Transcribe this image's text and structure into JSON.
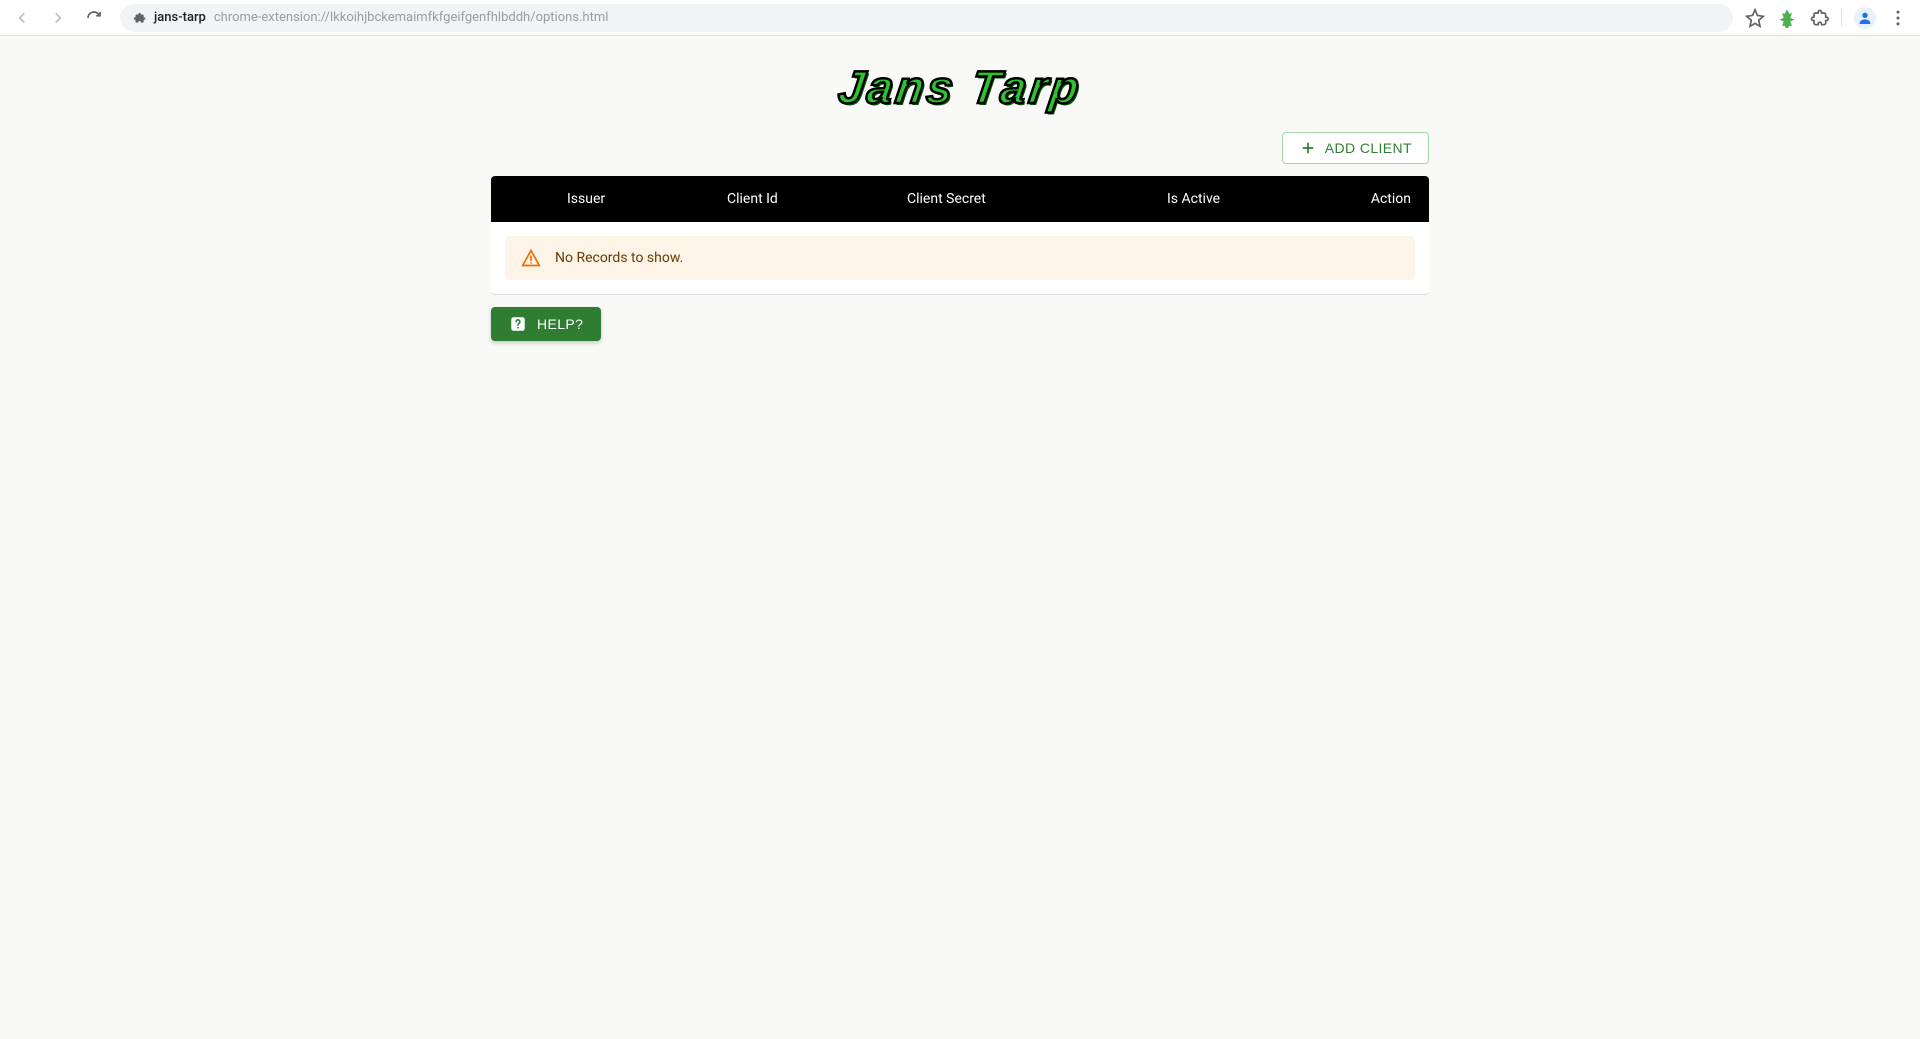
{
  "browser": {
    "page_title": "jans-tarp",
    "url": "chrome-extension://lkkoihjbckemaimfkfgeifgenfhlbddh/options.html"
  },
  "logo_text": "Jans Tarp",
  "actions": {
    "add_client_label": "ADD CLIENT"
  },
  "table": {
    "headers": {
      "issuer": "Issuer",
      "client_id": "Client Id",
      "client_secret": "Client Secret",
      "is_active": "Is Active",
      "action": "Action"
    },
    "empty_message": "No Records to show."
  },
  "help_label": "HELP?"
}
